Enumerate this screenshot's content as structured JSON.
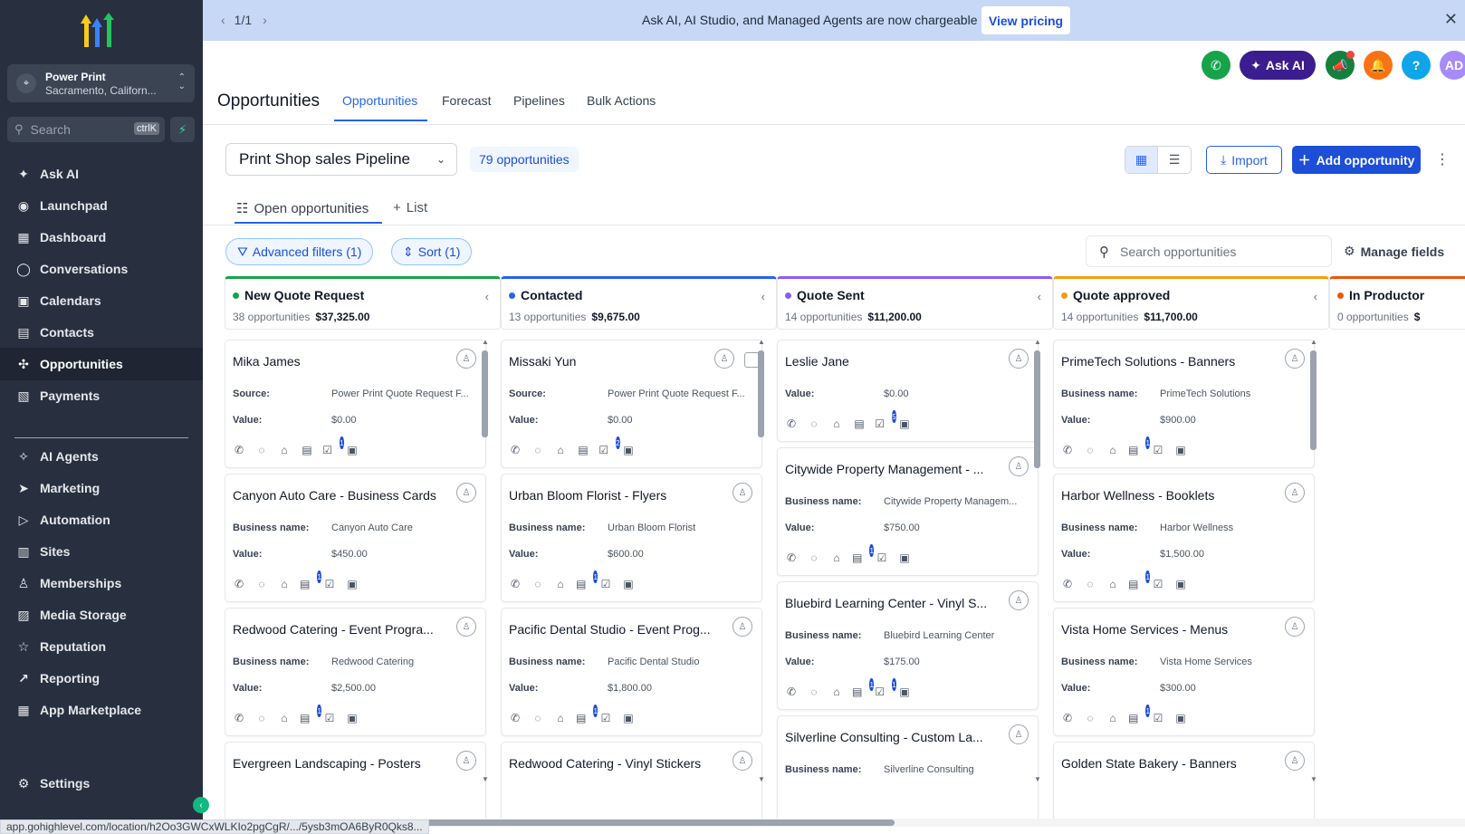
{
  "banner": {
    "pager": "1/1",
    "message": "Ask AI, AI Studio, and Managed Agents are now chargeable",
    "cta": "View pricing"
  },
  "account": {
    "name": "Power Print",
    "location": "Sacramento, Californ..."
  },
  "search": {
    "placeholder": "Search",
    "shortcut": "ctrlK"
  },
  "sidebar": {
    "items": [
      {
        "label": "Ask AI",
        "icon": "sparkle-icon"
      },
      {
        "label": "Launchpad",
        "icon": "rocket-icon"
      },
      {
        "label": "Dashboard",
        "icon": "dashboard-icon"
      },
      {
        "label": "Conversations",
        "icon": "chat-icon"
      },
      {
        "label": "Calendars",
        "icon": "calendar-icon"
      },
      {
        "label": "Contacts",
        "icon": "contacts-icon"
      },
      {
        "label": "Opportunities",
        "icon": "opportunities-icon"
      },
      {
        "label": "Payments",
        "icon": "payments-icon"
      },
      {
        "label": "AI Agents",
        "icon": "ai-agents-icon"
      },
      {
        "label": "Marketing",
        "icon": "send-icon"
      },
      {
        "label": "Automation",
        "icon": "automation-icon"
      },
      {
        "label": "Sites",
        "icon": "sites-icon"
      },
      {
        "label": "Memberships",
        "icon": "memberships-icon"
      },
      {
        "label": "Media Storage",
        "icon": "media-icon"
      },
      {
        "label": "Reputation",
        "icon": "star-icon"
      },
      {
        "label": "Reporting",
        "icon": "reporting-icon"
      },
      {
        "label": "App Marketplace",
        "icon": "marketplace-icon"
      },
      {
        "label": "Settings",
        "icon": "gear-icon"
      }
    ]
  },
  "topbar": {
    "ask_ai": "Ask AI",
    "avatar": "AD"
  },
  "header": {
    "title": "Opportunities",
    "tabs": [
      "Opportunities",
      "Forecast",
      "Pipelines",
      "Bulk Actions"
    ]
  },
  "toolbar": {
    "pipeline": "Print Shop sales Pipeline",
    "count": "79 opportunities",
    "import": "Import",
    "add": "Add opportunity"
  },
  "subtabs": {
    "open": "Open opportunities",
    "list": "List"
  },
  "filters": {
    "advanced": "Advanced filters (1)",
    "sort": "Sort (1)",
    "search_placeholder": "Search opportunities",
    "manage": "Manage fields"
  },
  "columns": [
    {
      "name": "New Quote Request",
      "count": "38 opportunities",
      "total": "$37,325.00",
      "color": "#16a34a",
      "cards": [
        {
          "title": "Mika James",
          "k1": "Source:",
          "v1": "Power Print Quote Request F...",
          "k2": "Value:",
          "v2": "$0.00",
          "badge": "1"
        },
        {
          "title": "Canyon Auto Care - Business Cards",
          "k1": "Business name:",
          "v1": "Canyon Auto Care",
          "k2": "Value:",
          "v2": "$450.00",
          "badge": "1"
        },
        {
          "title": "Redwood Catering - Event Progra...",
          "k1": "Business name:",
          "v1": "Redwood Catering",
          "k2": "Value:",
          "v2": "$2,500.00",
          "badge": "1"
        },
        {
          "title": "Evergreen Landscaping - Posters",
          "k1": "",
          "v1": "",
          "k2": "",
          "v2": "",
          "badge": ""
        }
      ]
    },
    {
      "name": "Contacted",
      "count": "13 opportunities",
      "total": "$9,675.00",
      "color": "#2563eb",
      "cards": [
        {
          "title": "Missaki Yun",
          "k1": "Source:",
          "v1": "Power Print Quote Request F...",
          "k2": "Value:",
          "v2": "$0.00",
          "badge": "2"
        },
        {
          "title": "Urban Bloom Florist - Flyers",
          "k1": "Business name:",
          "v1": "Urban Bloom Florist",
          "k2": "Value:",
          "v2": "$600.00",
          "badge": "1"
        },
        {
          "title": "Pacific Dental Studio - Event Prog...",
          "k1": "Business name:",
          "v1": "Pacific Dental Studio",
          "k2": "Value:",
          "v2": "$1,800.00",
          "badge": "1"
        },
        {
          "title": "Redwood Catering - Vinyl Stickers",
          "k1": "",
          "v1": "",
          "k2": "",
          "v2": "",
          "badge": ""
        }
      ]
    },
    {
      "name": "Quote Sent",
      "count": "14 opportunities",
      "total": "$11,200.00",
      "color": "#8b5cf6",
      "cards": [
        {
          "title": "Leslie Jane",
          "k1": "Value:",
          "v1": "$0.00",
          "k2": "",
          "v2": "",
          "badge": "5"
        },
        {
          "title": "Citywide Property Management - ...",
          "k1": "Business name:",
          "v1": "Citywide Property Managem...",
          "k2": "Value:",
          "v2": "$750.00",
          "badge": "1"
        },
        {
          "title": "Bluebird Learning Center - Vinyl S...",
          "k1": "Business name:",
          "v1": "Bluebird Learning Center",
          "k2": "Value:",
          "v2": "$175.00",
          "badge": "1",
          "badge2": "1"
        },
        {
          "title": "Silverline Consulting - Custom La...",
          "k1": "Business name:",
          "v1": "Silverline Consulting",
          "k2": "",
          "v2": "",
          "badge": ""
        }
      ]
    },
    {
      "name": "Quote approved",
      "count": "14 opportunities",
      "total": "$11,700.00",
      "color": "#f59e0b",
      "cards": [
        {
          "title": "PrimeTech Solutions - Banners",
          "k1": "Business name:",
          "v1": "PrimeTech Solutions",
          "k2": "Value:",
          "v2": "$900.00",
          "badge": "1"
        },
        {
          "title": "Harbor Wellness - Booklets",
          "k1": "Business name:",
          "v1": "Harbor Wellness",
          "k2": "Value:",
          "v2": "$1,500.00",
          "badge": "1"
        },
        {
          "title": "Vista Home Services - Menus",
          "k1": "Business name:",
          "v1": "Vista Home Services",
          "k2": "Value:",
          "v2": "$300.00",
          "badge": "1"
        },
        {
          "title": "Golden State Bakery - Banners",
          "k1": "",
          "v1": "",
          "k2": "",
          "v2": "",
          "badge": ""
        }
      ]
    },
    {
      "name": "In Productor",
      "count": "0 opportunities",
      "total": "$",
      "color": "#ea580c",
      "cards": []
    }
  ],
  "status_url": "app.gohighlevel.com/location/h2Oo3GWCxWLKIo2pgCgR/.../5ysb3mOA6ByR0Qks8..."
}
